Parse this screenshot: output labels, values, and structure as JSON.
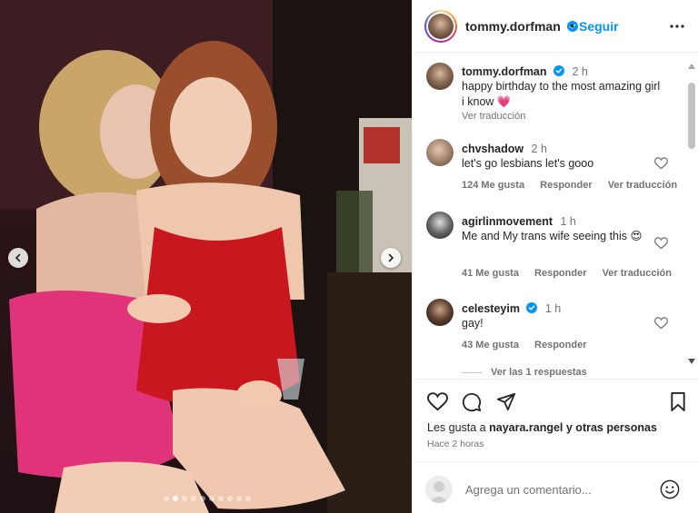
{
  "header": {
    "username": "tommy.dorfman",
    "separator": "•",
    "follow_label": "Seguir"
  },
  "comments": [
    {
      "username": "tommy.dorfman",
      "verified": true,
      "time": "2 h",
      "text": "happy birthday to the most amazing girl i know 💗",
      "translate_label": "Ver traducción"
    },
    {
      "username": "chvshadow",
      "time": "2 h",
      "text": "let's go lesbians let's gooo",
      "likes_label": "124 Me gusta",
      "reply_label": "Responder",
      "translate_label": "Ver traducción"
    },
    {
      "username": "agirlinmovement",
      "time": "1 h",
      "text": "Me and My trans wife seeing this 😍",
      "likes_label": "41 Me gusta",
      "reply_label": "Responder",
      "translate_label": "Ver traducción"
    },
    {
      "username": "celesteyim",
      "verified": true,
      "time": "1 h",
      "text": "gay!",
      "likes_label": "43 Me gusta",
      "reply_label": "Responder"
    }
  ],
  "view_replies_label": "Ver las 1 respuestas",
  "likes": {
    "prefix": "Les gusta a ",
    "user": "nayara.rangel",
    "suffix": " y otras personas"
  },
  "posted_ago": "Hace 2 horas",
  "add_comment": {
    "placeholder": "Agrega un comentario..."
  },
  "carousel": {
    "total_slides": 10,
    "active_index": 1
  },
  "icons": {
    "like": "heart-icon",
    "comment": "comment-icon",
    "share": "send-icon",
    "save": "bookmark-icon",
    "more": "more-options-icon",
    "emoji": "emoji-icon"
  },
  "colors": {
    "accent": "#0095f6",
    "verified": "#0095f6",
    "text": "#262626",
    "muted": "#737373"
  }
}
